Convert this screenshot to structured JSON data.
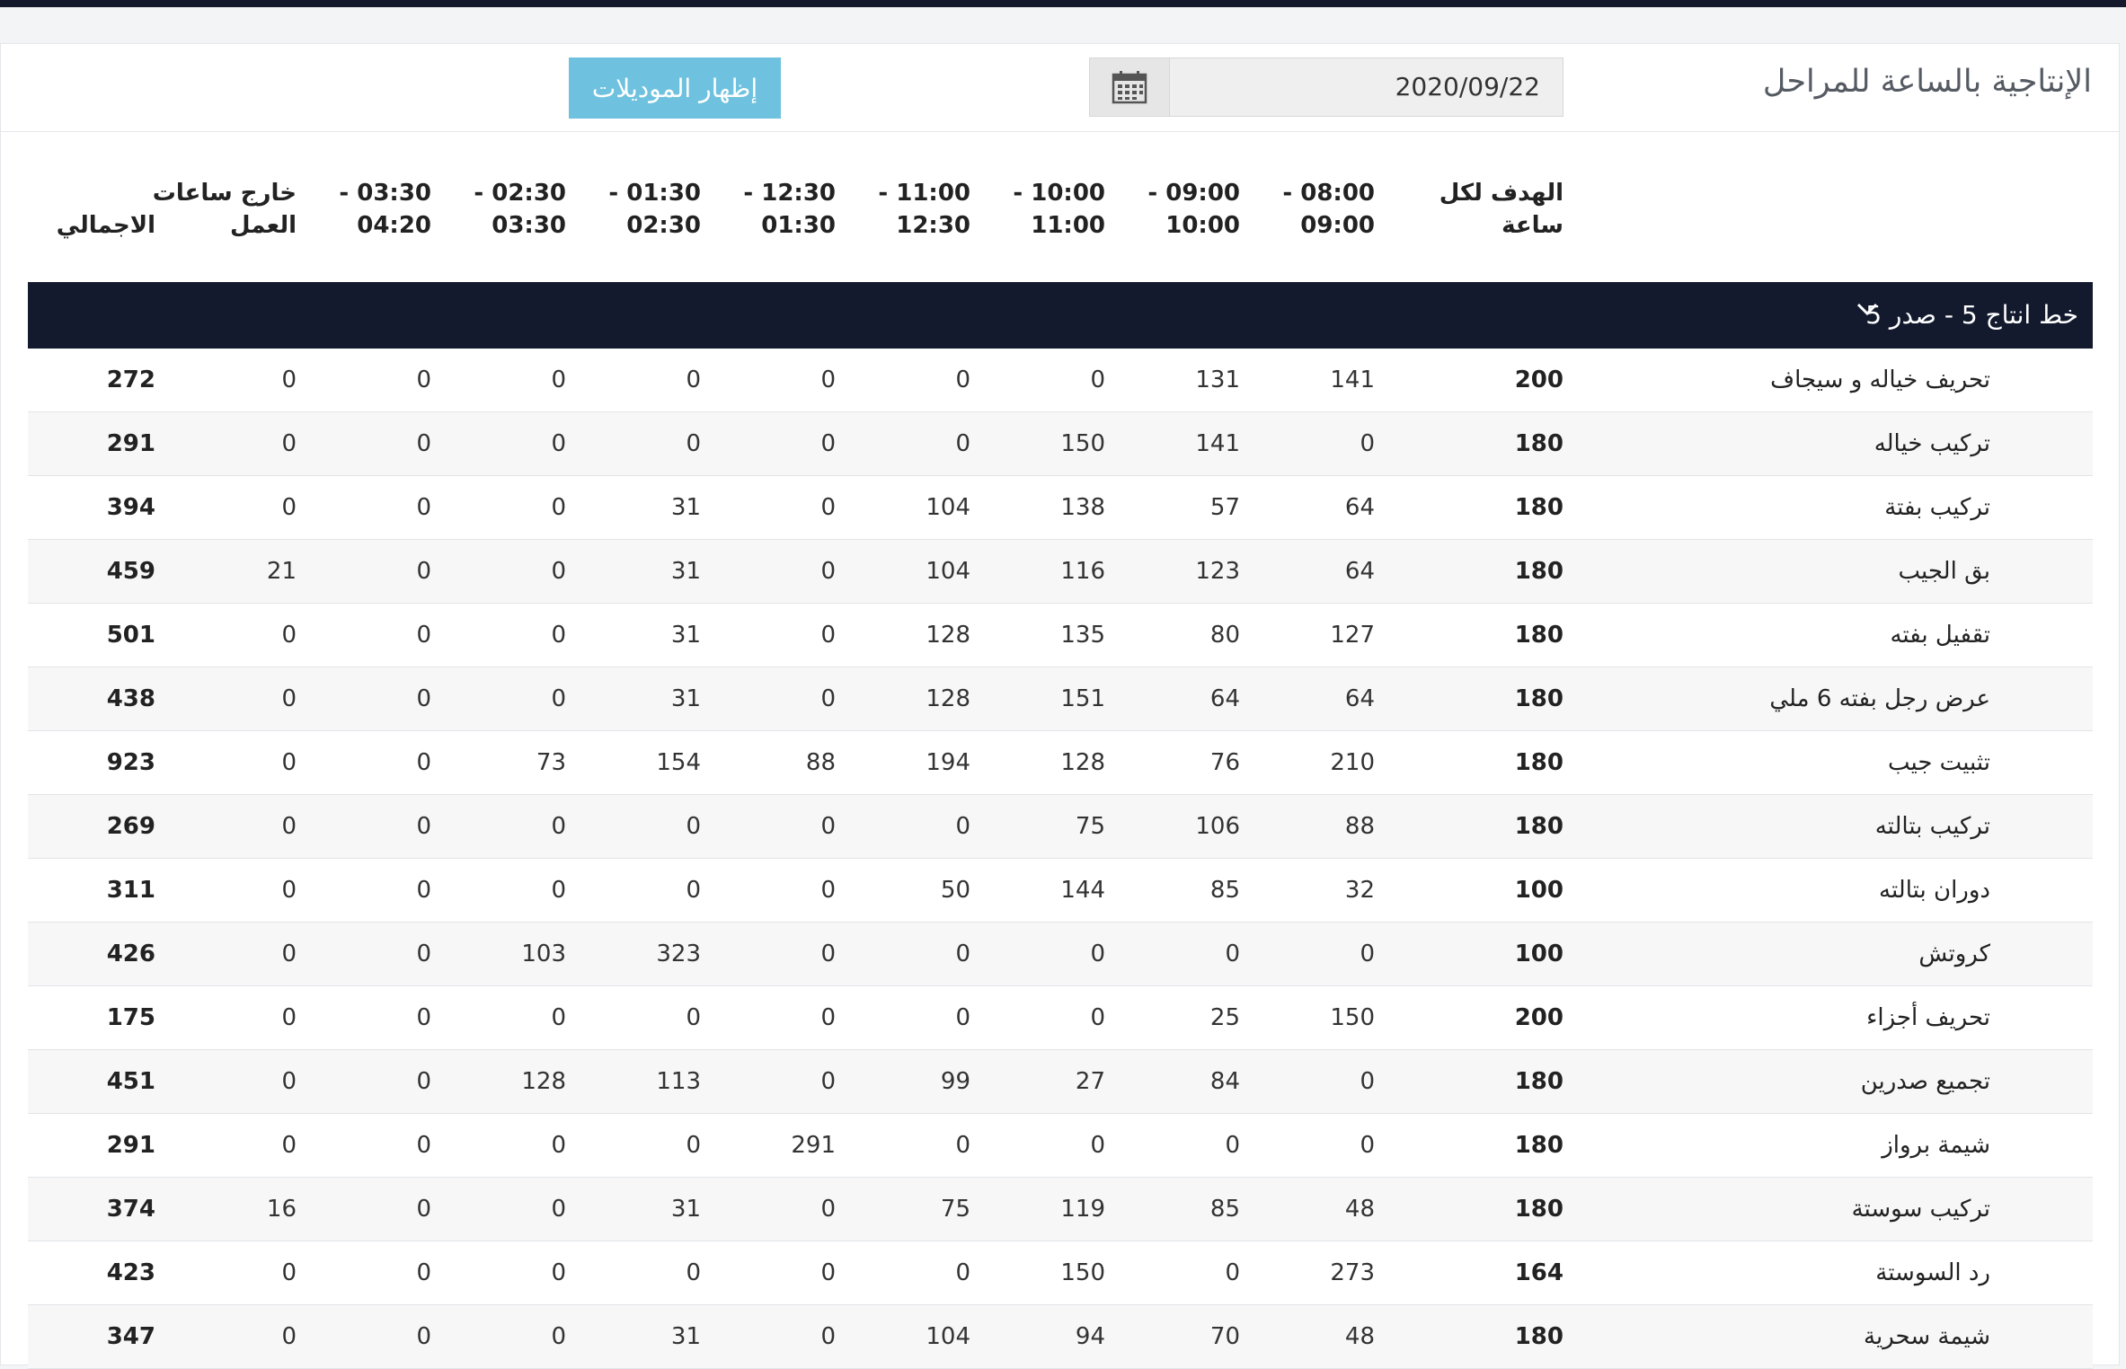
{
  "page_title": "الإنتاجية بالساعة للمراحل",
  "date_picker": {
    "value": "2020/09/22",
    "icon": "calendar-icon"
  },
  "show_models_label": "إظهار الموديلات",
  "colors": {
    "accent": "#6fc2df",
    "group_header": "#131a2e",
    "top_bar": "#141a2c"
  },
  "columns": {
    "target": [
      "الهدف لكل",
      "ساعة"
    ],
    "slots": [
      [
        "08:00 -",
        "09:00"
      ],
      [
        "09:00 -",
        "10:00"
      ],
      [
        "10:00 -",
        "11:00"
      ],
      [
        "11:00 -",
        "12:30"
      ],
      [
        "12:30 -",
        "01:30"
      ],
      [
        "01:30 -",
        "02:30"
      ],
      [
        "02:30 -",
        "03:30"
      ],
      [
        "03:30 -",
        "04:20"
      ]
    ],
    "overtime": [
      "خارج ساعات",
      "العمل"
    ],
    "total": "الاجمالي"
  },
  "group": {
    "label": "خط انتاج 5 - صدر 5",
    "icon": "chevron-down-icon"
  },
  "rows": [
    {
      "stage": "تحريف خياله و سيجاف",
      "target": "200",
      "slots": [
        "141",
        "131",
        "0",
        "0",
        "0",
        "0",
        "0",
        "0"
      ],
      "overtime": "0",
      "total": "272"
    },
    {
      "stage": "تركيب خياله",
      "target": "180",
      "slots": [
        "0",
        "141",
        "150",
        "0",
        "0",
        "0",
        "0",
        "0"
      ],
      "overtime": "0",
      "total": "291"
    },
    {
      "stage": "تركيب بفتة",
      "target": "180",
      "slots": [
        "64",
        "57",
        "138",
        "104",
        "0",
        "31",
        "0",
        "0"
      ],
      "overtime": "0",
      "total": "394"
    },
    {
      "stage": "بق الجيب",
      "target": "180",
      "slots": [
        "64",
        "123",
        "116",
        "104",
        "0",
        "31",
        "0",
        "0"
      ],
      "overtime": "21",
      "total": "459"
    },
    {
      "stage": "تقفيل بفته",
      "target": "180",
      "slots": [
        "127",
        "80",
        "135",
        "128",
        "0",
        "31",
        "0",
        "0"
      ],
      "overtime": "0",
      "total": "501"
    },
    {
      "stage": "عرض رجل بفته 6 ملي",
      "target": "180",
      "slots": [
        "64",
        "64",
        "151",
        "128",
        "0",
        "31",
        "0",
        "0"
      ],
      "overtime": "0",
      "total": "438"
    },
    {
      "stage": "تثبيت جيب",
      "target": "180",
      "slots": [
        "210",
        "76",
        "128",
        "194",
        "88",
        "154",
        "73",
        "0"
      ],
      "overtime": "0",
      "total": "923"
    },
    {
      "stage": "تركيب بتالته",
      "target": "180",
      "slots": [
        "88",
        "106",
        "75",
        "0",
        "0",
        "0",
        "0",
        "0"
      ],
      "overtime": "0",
      "total": "269"
    },
    {
      "stage": "دوران بتالته",
      "target": "100",
      "slots": [
        "32",
        "85",
        "144",
        "50",
        "0",
        "0",
        "0",
        "0"
      ],
      "overtime": "0",
      "total": "311"
    },
    {
      "stage": "كروتش",
      "target": "100",
      "slots": [
        "0",
        "0",
        "0",
        "0",
        "0",
        "323",
        "103",
        "0"
      ],
      "overtime": "0",
      "total": "426"
    },
    {
      "stage": "تحريف أجزاء",
      "target": "200",
      "slots": [
        "150",
        "25",
        "0",
        "0",
        "0",
        "0",
        "0",
        "0"
      ],
      "overtime": "0",
      "total": "175"
    },
    {
      "stage": "تجميع صدرين",
      "target": "180",
      "slots": [
        "0",
        "84",
        "27",
        "99",
        "0",
        "113",
        "128",
        "0"
      ],
      "overtime": "0",
      "total": "451"
    },
    {
      "stage": "شيمة برواز",
      "target": "180",
      "slots": [
        "0",
        "0",
        "0",
        "0",
        "291",
        "0",
        "0",
        "0"
      ],
      "overtime": "0",
      "total": "291"
    },
    {
      "stage": "تركيب سوستة",
      "target": "180",
      "slots": [
        "48",
        "85",
        "119",
        "75",
        "0",
        "31",
        "0",
        "0"
      ],
      "overtime": "16",
      "total": "374"
    },
    {
      "stage": "رد السوستة",
      "target": "164",
      "slots": [
        "273",
        "0",
        "150",
        "0",
        "0",
        "0",
        "0",
        "0"
      ],
      "overtime": "0",
      "total": "423"
    },
    {
      "stage": "شيمة سحرية",
      "target": "180",
      "slots": [
        "48",
        "70",
        "94",
        "104",
        "0",
        "31",
        "0",
        "0"
      ],
      "overtime": "0",
      "total": "347"
    }
  ]
}
